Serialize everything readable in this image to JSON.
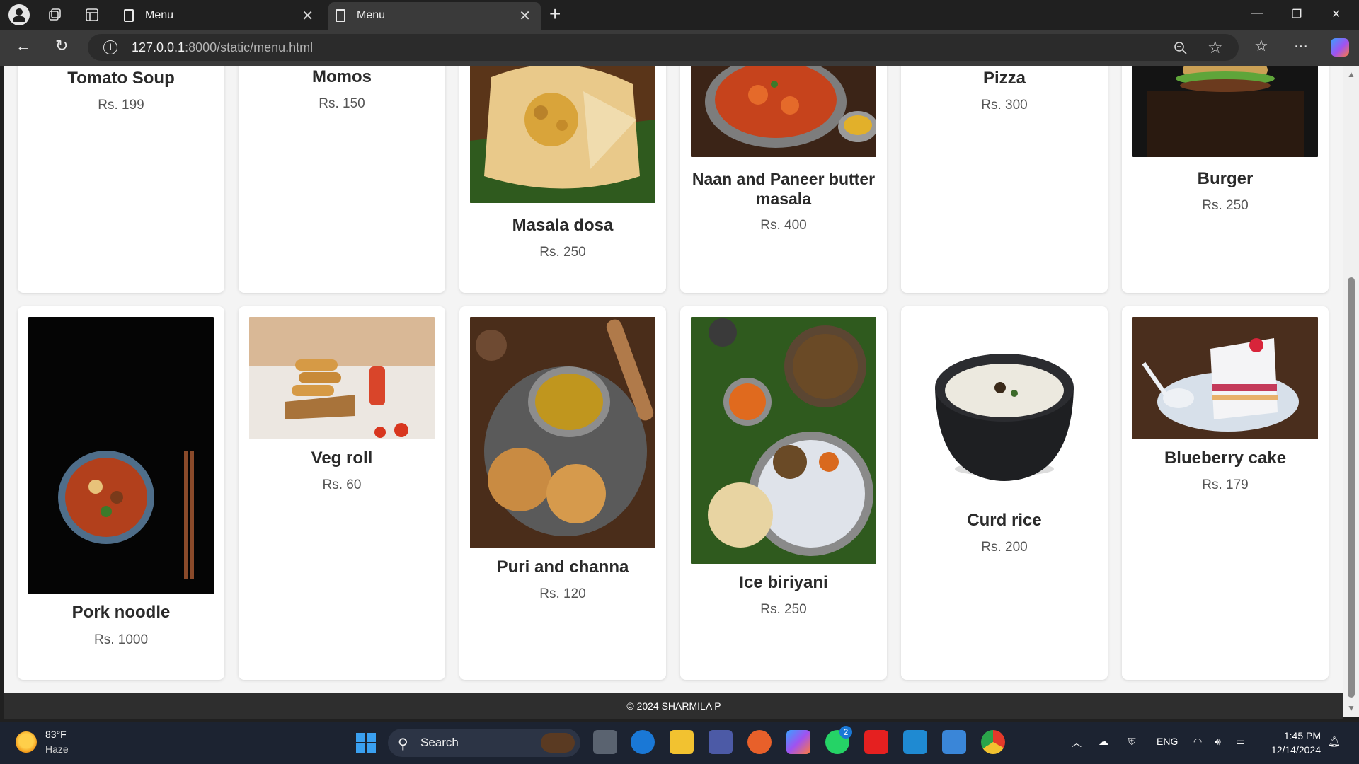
{
  "browser": {
    "tabs": [
      {
        "title": "Menu"
      },
      {
        "title": "Menu"
      }
    ],
    "url_host": "127.0.0.1",
    "url_rest": ":8000/static/menu.html"
  },
  "menu": {
    "row1": [
      {
        "name": "Tomato Soup",
        "price": "Rs. 199",
        "image": "none"
      },
      {
        "name": "Momos",
        "price": "Rs. 150",
        "image": "none"
      },
      {
        "name": "Masala dosa",
        "price": "Rs. 250",
        "image": "masala-dosa-photo"
      },
      {
        "name": "Naan and Paneer butter masala",
        "price": "Rs. 400",
        "image": "paneer-curry-photo"
      },
      {
        "name": "Pizza",
        "price": "Rs. 300",
        "image": "none"
      },
      {
        "name": "Burger",
        "price": "Rs. 250",
        "image": "burger-photo"
      }
    ],
    "row2": [
      {
        "name": "Pork noodle",
        "price": "Rs. 1000",
        "image": "pork-noodle-photo"
      },
      {
        "name": "Veg roll",
        "price": "Rs. 60",
        "image": "veg-roll-photo"
      },
      {
        "name": "Puri and channa",
        "price": "Rs. 120",
        "image": "puri-channa-photo"
      },
      {
        "name": "Ice biriyani",
        "price": "Rs. 250",
        "image": "ice-biriyani-photo"
      },
      {
        "name": "Curd rice",
        "price": "Rs. 200",
        "image": "curd-rice-photo"
      },
      {
        "name": "Blueberry cake",
        "price": "Rs. 179",
        "image": "blueberry-cake-photo"
      }
    ]
  },
  "footer": {
    "text": "© 2024 SHARMILA P"
  },
  "taskbar": {
    "weather_temp": "83°F",
    "weather_condition": "Haze",
    "search_label": "Search",
    "whatsapp_badge": "2",
    "language": "ENG",
    "time": "1:45 PM",
    "date": "12/14/2024"
  }
}
